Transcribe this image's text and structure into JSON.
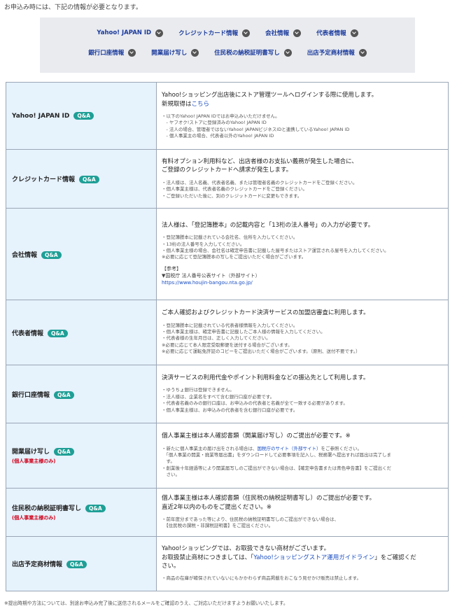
{
  "intro": "お申込み時には、下記の情報が必要となります。",
  "nav": {
    "row1": [
      "Yahoo! JAPAN ID",
      "クレジットカード情報",
      "会社情報",
      "代表者情報"
    ],
    "row2": [
      "銀行口座情報",
      "開業届け写し",
      "住民税の納税証明書写し",
      "出店予定商材情報"
    ]
  },
  "qa_label": "Q&A",
  "rows": [
    {
      "label": "Yahoo! JAPAN ID",
      "main": [
        "Yahoo!ショッピング出店後にストア管理ツールへログインする際に使用します。"
      ],
      "link_prefix": "新規取得は",
      "link_text": "こちら",
      "notes": [
        "・以下のYahoo! JAPAN IDではお申込みいただけません。",
        "　- ヤフオク!ストアに登録済みのYahoo! JAPAN ID",
        "　- 法人の場合、管理者ではないYahoo! JAPANビジネスIDと連携しているYahoo! JAPAN ID",
        "　- 個人事業主の場合、代表者以外のYahoo! JAPAN ID"
      ]
    },
    {
      "label": "クレジットカード情報",
      "main": [
        "有料オプション利用料など、出店者様のお支払い義務が発生した場合に、",
        "ご登録のクレジットカードへ請求が発生します。"
      ],
      "notes": [
        "・法人様は、法人名義、代表者名義、または管理者名義のクレジットカードをご登録ください。",
        "・個人事業主様は、代表者名義のクレジットカードをご登録ください。",
        "・ご登録いただいた後に、別のクレジットカードに変更もできます。"
      ]
    },
    {
      "label": "会社情報",
      "main": [
        "法人様は、「登記簿謄本」の記載内容と「13桁の法人番号」の入力が必要です。"
      ],
      "notes": [
        "・登記簿謄本に記載されている会社名、住所を入力してください。",
        "・13桁の法人番号を入力してください。",
        "・個人事業主様の場合、会社名は確定申告書に記載した屋号またはストア運営される屋号を入力してください。",
        "※必要に応じて登記簿謄本の写しをご提出いただく場合がございます。"
      ],
      "ref": [
        "【参考】",
        "▼国税庁 法人番号公表サイト（外部サイト）"
      ],
      "ref_url": "https://www.houjin-bangou.nta.go.jp/"
    },
    {
      "label": "代表者情報",
      "main": [
        "ご本人確認およびクレジットカード決済サービスの加盟店審査に利用します。"
      ],
      "notes": [
        "・登記簿謄本に記載されている代表者様情報を入力してください。",
        "・個人事業主様は、確定申告書に記載したご本人様の情報を入力してください。",
        "・代表者様の生年月日は、正しく入力してください。",
        "※必要に応じて本人限定受取郵便を送付する場合がございます。",
        "※必要に応じて運転免許証のコピーをご提出いただく場合がございます。（原則、送付不要です。）"
      ]
    },
    {
      "label": "銀行口座情報",
      "main": [
        "決済サービスの利用代金やポイント利用料金などの振込先として利用します。"
      ],
      "notes": [
        "・ゆうちょ銀行は登録できません。",
        "・法人様は、企業名をすべて含む銀行口座が必要です。",
        "・代表者名義のみの銀行口座は、お申込みの代表者と名義が全て一致する必要があります。",
        "・個人事業主様は、お申込みの代表者を含む銀行口座が必要です。"
      ]
    },
    {
      "label": "開業届け写し",
      "sub": "(個人事業主様のみ)",
      "main": [
        "個人事業主様は本人確認書類（開業届け写し）のご提出が必要です。※"
      ],
      "notes_rich": [
        {
          "pre": "・新たに個人事業主の届け出をされる場合は、",
          "link": "国税庁のサイト（外部サイト）",
          "post": "をご参照ください。"
        },
        {
          "pre": "　「個人事業の開業・廃業等届出書」をダウンロードして必要事項を記入し、税務署へ提出すれば届出は完了しま",
          "link": "",
          "post": ""
        },
        {
          "pre": "　す。",
          "link": "",
          "post": ""
        },
        {
          "pre": "・創業後十年経過等により開業届写しのご提出ができない場合は、【確定申告書または青色申告書】をご提出くだ",
          "link": "",
          "post": ""
        },
        {
          "pre": "　さい。",
          "link": "",
          "post": ""
        }
      ]
    },
    {
      "label": "住民税の納税証明書写し",
      "sub": "(個人事業主様のみ)",
      "main": [
        "個人事業主様は本人確認書類（住民税の納税証明書写し）のご提出が必要です。",
        "直近2年以内のものをご提出ください。※"
      ],
      "notes": [
        "・前年度分まであった等により、住民税の納税証明書写しのご提出ができない場合は、",
        "　【住民税の課税・非課税証明書】をご提出ください。"
      ]
    },
    {
      "label": "出店予定商材情報",
      "main": [
        "Yahoo!ショッピングでは、お取扱できない商材がございます。"
      ],
      "main2_pre": "お取扱禁止商材につきましては、「",
      "main2_link": "Yahoo!ショッピングストア運用ガイドライン",
      "main2_post": "」をご確認くだ",
      "main3": "さい。",
      "notes": [
        "・商品の在庫が確保されていないにもかかわらず商品掲載をおこなう見せかけ販売は禁止します。"
      ]
    }
  ],
  "footnote": "※提出時期や方法については、別途お申込み完了後に送信されるメールをご確認のうえ、ご対応いただけますようお願いいたします。"
}
